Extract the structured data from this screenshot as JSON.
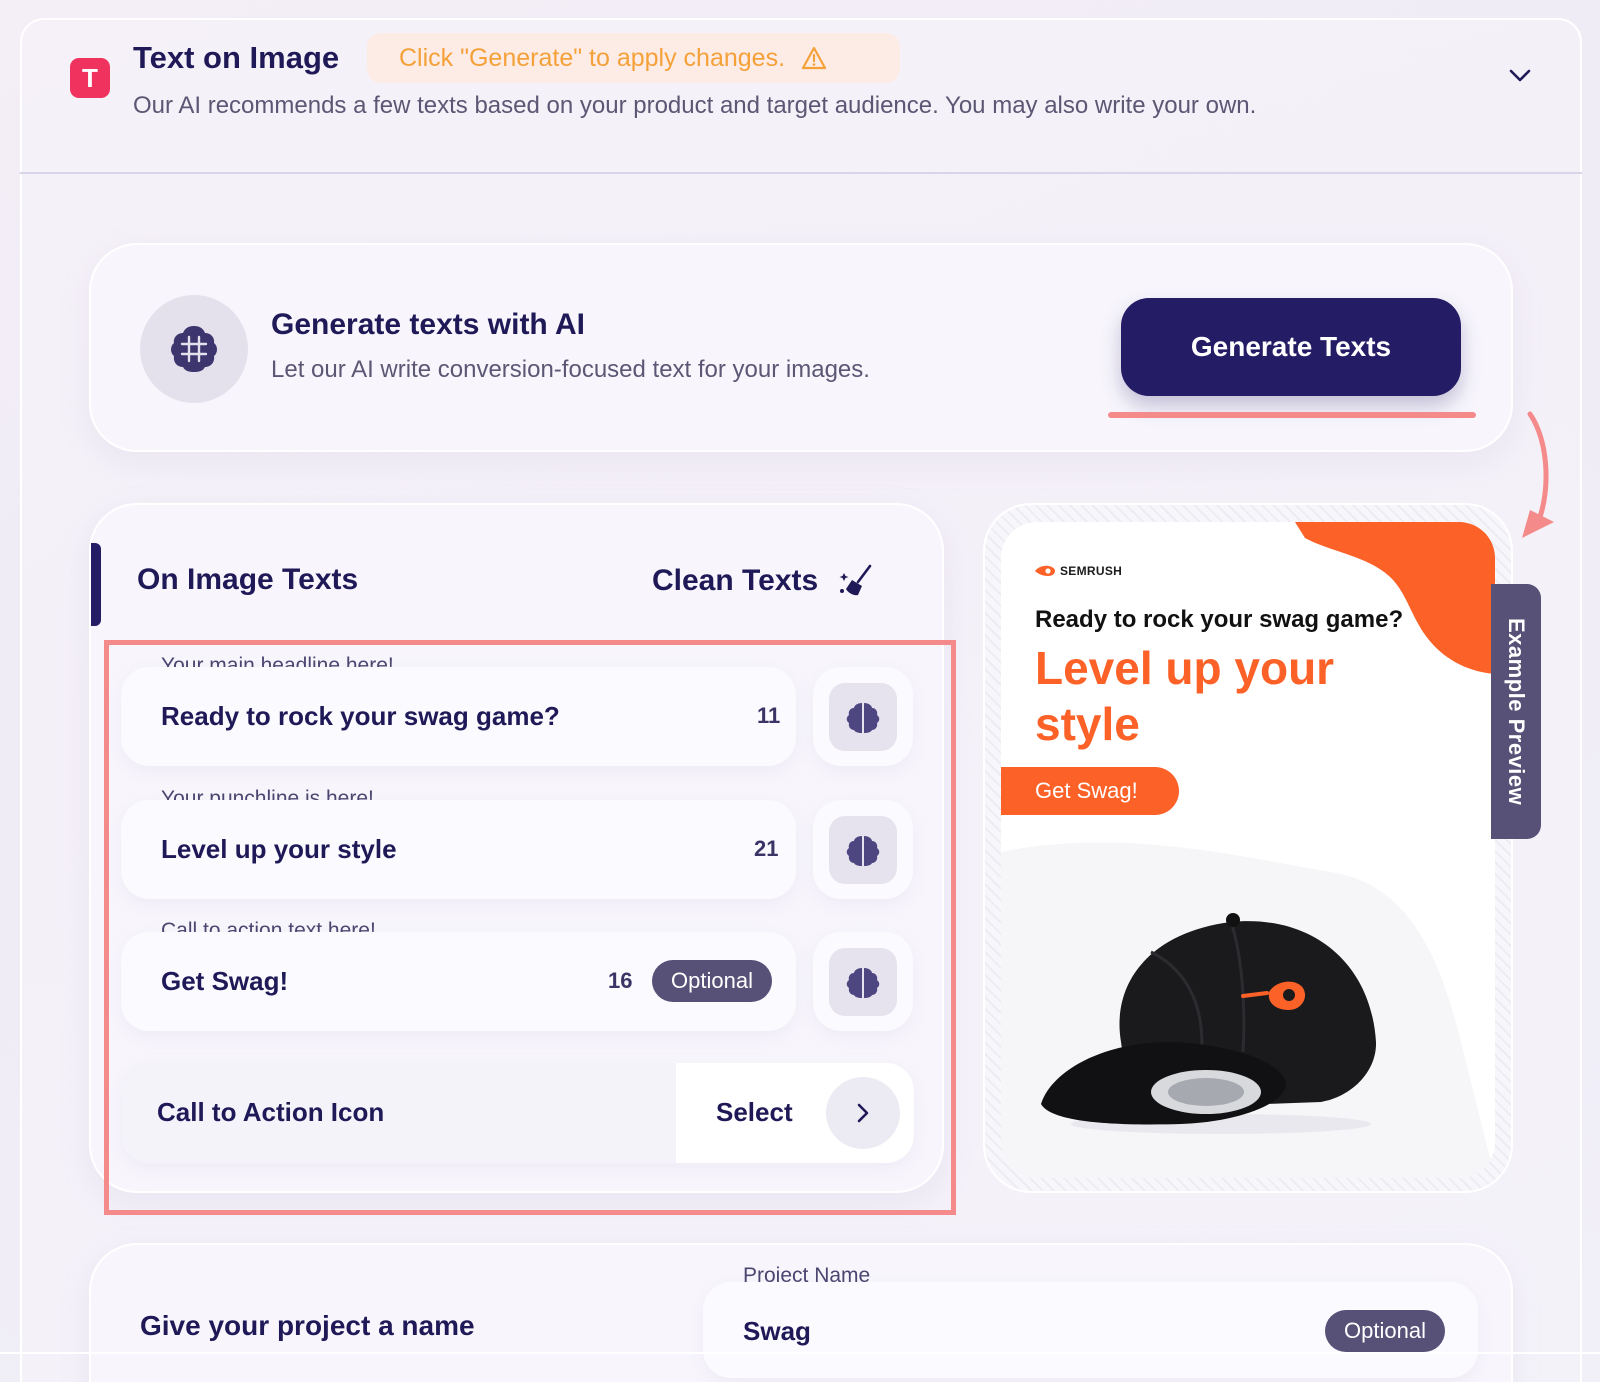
{
  "section": {
    "badge": "T",
    "title": "Text on Image",
    "warning": "Click \"Generate\" to apply changes.",
    "subtitle": "Our AI recommends a few texts based on your product and target audience. You may also write your own."
  },
  "ai_generate": {
    "title": "Generate texts with AI",
    "subtitle": "Let our AI write conversion-focused text for your images.",
    "button_label": "Generate Texts"
  },
  "on_image_texts": {
    "title": "On Image Texts",
    "clean_label": "Clean Texts",
    "fields": [
      {
        "label": "Your main headline here!",
        "value": "Ready to rock your swag game?",
        "count": "11",
        "optional": ""
      },
      {
        "label": "Your punchline is here!",
        "value": "Level up your style",
        "count": "21",
        "optional": ""
      },
      {
        "label": "Call to action text here!",
        "value": "Get Swag!",
        "count": "16",
        "optional": "Optional"
      }
    ],
    "cta_icon": {
      "label": "Call to Action Icon",
      "select_label": "Select"
    }
  },
  "preview": {
    "brand": "SEMRUSH",
    "headline": "Ready to rock your swag game?",
    "punchline": "Level up your style",
    "cta": "Get Swag!",
    "tab_label": "Example Preview",
    "accent_color": "#fc6128"
  },
  "project": {
    "title": "Give your project a name",
    "field_label": "Project Name",
    "value": "Swag",
    "optional": "Optional"
  },
  "colors": {
    "primary": "#251c66",
    "accent_red": "#f48a8a",
    "badge": "#f0325f",
    "warning": "#f5a13a"
  }
}
